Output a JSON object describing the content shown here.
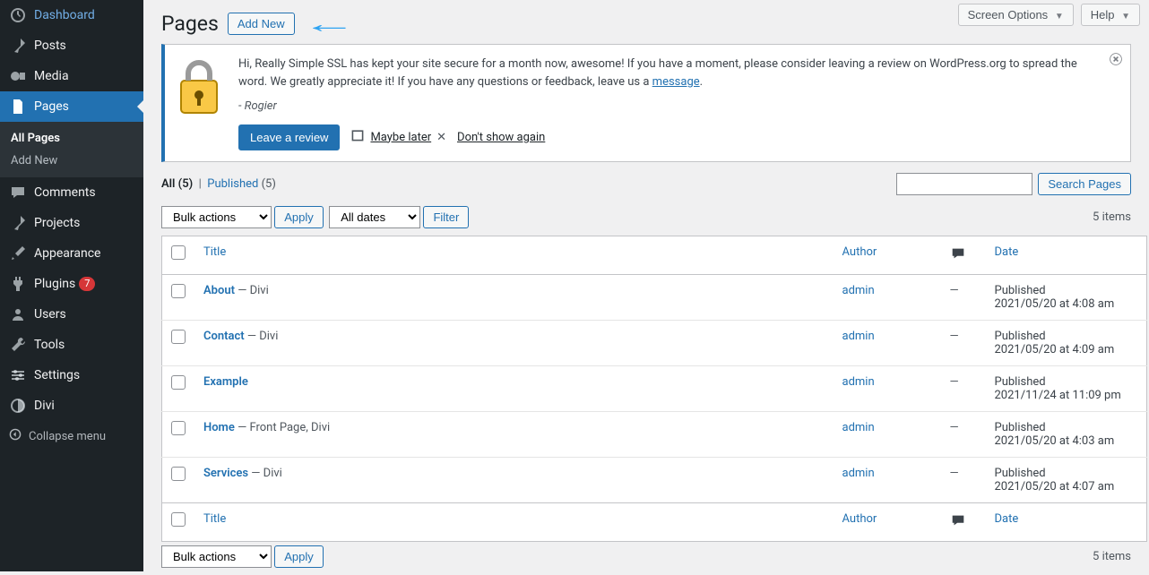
{
  "topbar": {
    "screen_options": "Screen Options",
    "help": "Help"
  },
  "header": {
    "title": "Pages",
    "add_new": "Add New"
  },
  "sidebar": {
    "items": [
      {
        "label": "Dashboard",
        "icon": "⌬"
      },
      {
        "label": "Posts",
        "icon": "✦"
      },
      {
        "label": "Media",
        "icon": "✣"
      },
      {
        "label": "Pages",
        "icon": "▤"
      },
      {
        "label": "Comments",
        "icon": "✉"
      },
      {
        "label": "Projects",
        "icon": "✦"
      },
      {
        "label": "Appearance",
        "icon": "✎"
      },
      {
        "label": "Plugins",
        "icon": "⚡",
        "badge": "7"
      },
      {
        "label": "Users",
        "icon": "👤"
      },
      {
        "label": "Tools",
        "icon": "✇"
      },
      {
        "label": "Settings",
        "icon": "⚙"
      },
      {
        "label": "Divi",
        "icon": "◑"
      }
    ],
    "sub": {
      "all_pages": "All Pages",
      "add_new": "Add New"
    },
    "collapse": "Collapse menu"
  },
  "notice": {
    "message_prefix": "Hi, Really Simple SSL has kept your site secure for a month now, awesome! If you have a moment, please consider leaving a review on WordPress.org to spread the word. We greatly appreciate it! If you have any questions or feedback, leave us a ",
    "message_link": "message",
    "signature": "- Rogier",
    "leave_review": "Leave a review",
    "maybe_later": "Maybe later",
    "dont_show": "Don't show again"
  },
  "filters": {
    "all_label": "All",
    "all_count": "(5)",
    "published_label": "Published",
    "published_count": "(5)",
    "bulk_actions": "Bulk actions",
    "apply": "Apply",
    "all_dates": "All dates",
    "filter": "Filter",
    "search_pages": "Search Pages",
    "items_count": "5 items"
  },
  "table": {
    "columns": {
      "title": "Title",
      "author": "Author",
      "date": "Date"
    },
    "rows": [
      {
        "title": "About",
        "suffix": " — Divi",
        "author": "admin",
        "comments": "—",
        "status": "Published",
        "datetime": "2021/05/20 at 4:08 am"
      },
      {
        "title": "Contact",
        "suffix": " — Divi",
        "author": "admin",
        "comments": "—",
        "status": "Published",
        "datetime": "2021/05/20 at 4:09 am"
      },
      {
        "title": "Example",
        "suffix": "",
        "author": "admin",
        "comments": "—",
        "status": "Published",
        "datetime": "2021/11/24 at 11:09 pm"
      },
      {
        "title": "Home",
        "suffix": " — Front Page, Divi",
        "author": "admin",
        "comments": "—",
        "status": "Published",
        "datetime": "2021/05/20 at 4:03 am"
      },
      {
        "title": "Services",
        "suffix": " — Divi",
        "author": "admin",
        "comments": "—",
        "status": "Published",
        "datetime": "2021/05/20 at 4:07 am"
      }
    ]
  }
}
